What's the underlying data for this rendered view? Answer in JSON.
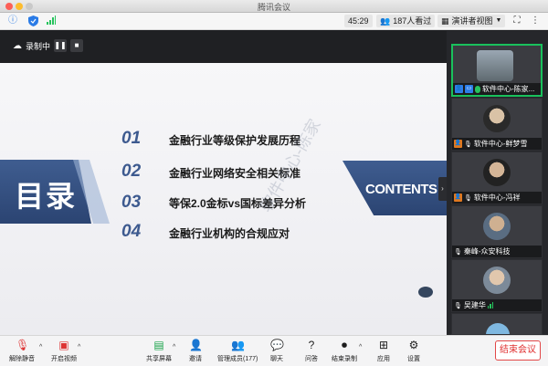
{
  "window": {
    "title": "腾讯会议"
  },
  "topbar": {
    "timer": "45:29",
    "viewers": "187人看过",
    "view_mode": "演讲者视图"
  },
  "recording": {
    "label": "录制中"
  },
  "slide": {
    "heading_left": "目录",
    "heading_right": "CONTENTS",
    "items": [
      {
        "num": "01",
        "text": "金融行业等级保护发展历程"
      },
      {
        "num": "02",
        "text": "金融行业网络安全相关标准"
      },
      {
        "num": "03",
        "text": "等保2.0金标vs国标差异分析"
      },
      {
        "num": "04",
        "text": "金融行业机构的合规应对"
      }
    ],
    "watermark": "软件中心-陈家"
  },
  "participants": [
    {
      "name": "软件中心-陈家...",
      "active": true,
      "role": "cohost"
    },
    {
      "name": "软件中心-鲜梦雪",
      "active": false,
      "role": "host"
    },
    {
      "name": "软件中心-冯祥",
      "active": false,
      "role": "host"
    },
    {
      "name": "秦峰-众安科技",
      "active": false,
      "role": ""
    },
    {
      "name": "吴建华",
      "active": false,
      "role": ""
    }
  ],
  "toolbar": {
    "unmute": "解除静音",
    "video": "开启视频",
    "share": "共享屏幕",
    "invite": "邀请",
    "members": "管理成员(177)",
    "chat": "聊天",
    "qa": "问答",
    "record": "结束录制",
    "apps": "应用",
    "settings": "设置",
    "end": "结束会议"
  },
  "colors": {
    "accent_blue": "#3d5a8f",
    "active_green": "#19c15c",
    "end_red": "#e03030"
  }
}
